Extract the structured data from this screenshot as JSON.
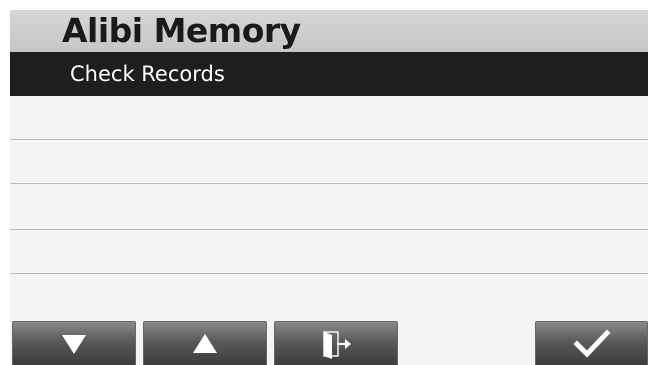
{
  "header": {
    "title": "Alibi Memory"
  },
  "menu": {
    "items": [
      {
        "label": "Check Records",
        "selected": true
      },
      {
        "label": "",
        "selected": false
      },
      {
        "label": "",
        "selected": false
      },
      {
        "label": "",
        "selected": false
      },
      {
        "label": "",
        "selected": false
      },
      {
        "label": "",
        "selected": false
      }
    ]
  },
  "softkeys": [
    {
      "icon": "arrow-down-icon"
    },
    {
      "icon": "arrow-up-icon"
    },
    {
      "icon": "exit-door-icon"
    },
    {
      "icon": "checkmark-icon"
    }
  ],
  "colors": {
    "header_bg": "#cccccc",
    "selected_row_bg": "#1e1e1e",
    "list_bg": "#f4f4f4",
    "divider": "#b8b8c8",
    "softkey_bg": "#4a4a4a"
  }
}
